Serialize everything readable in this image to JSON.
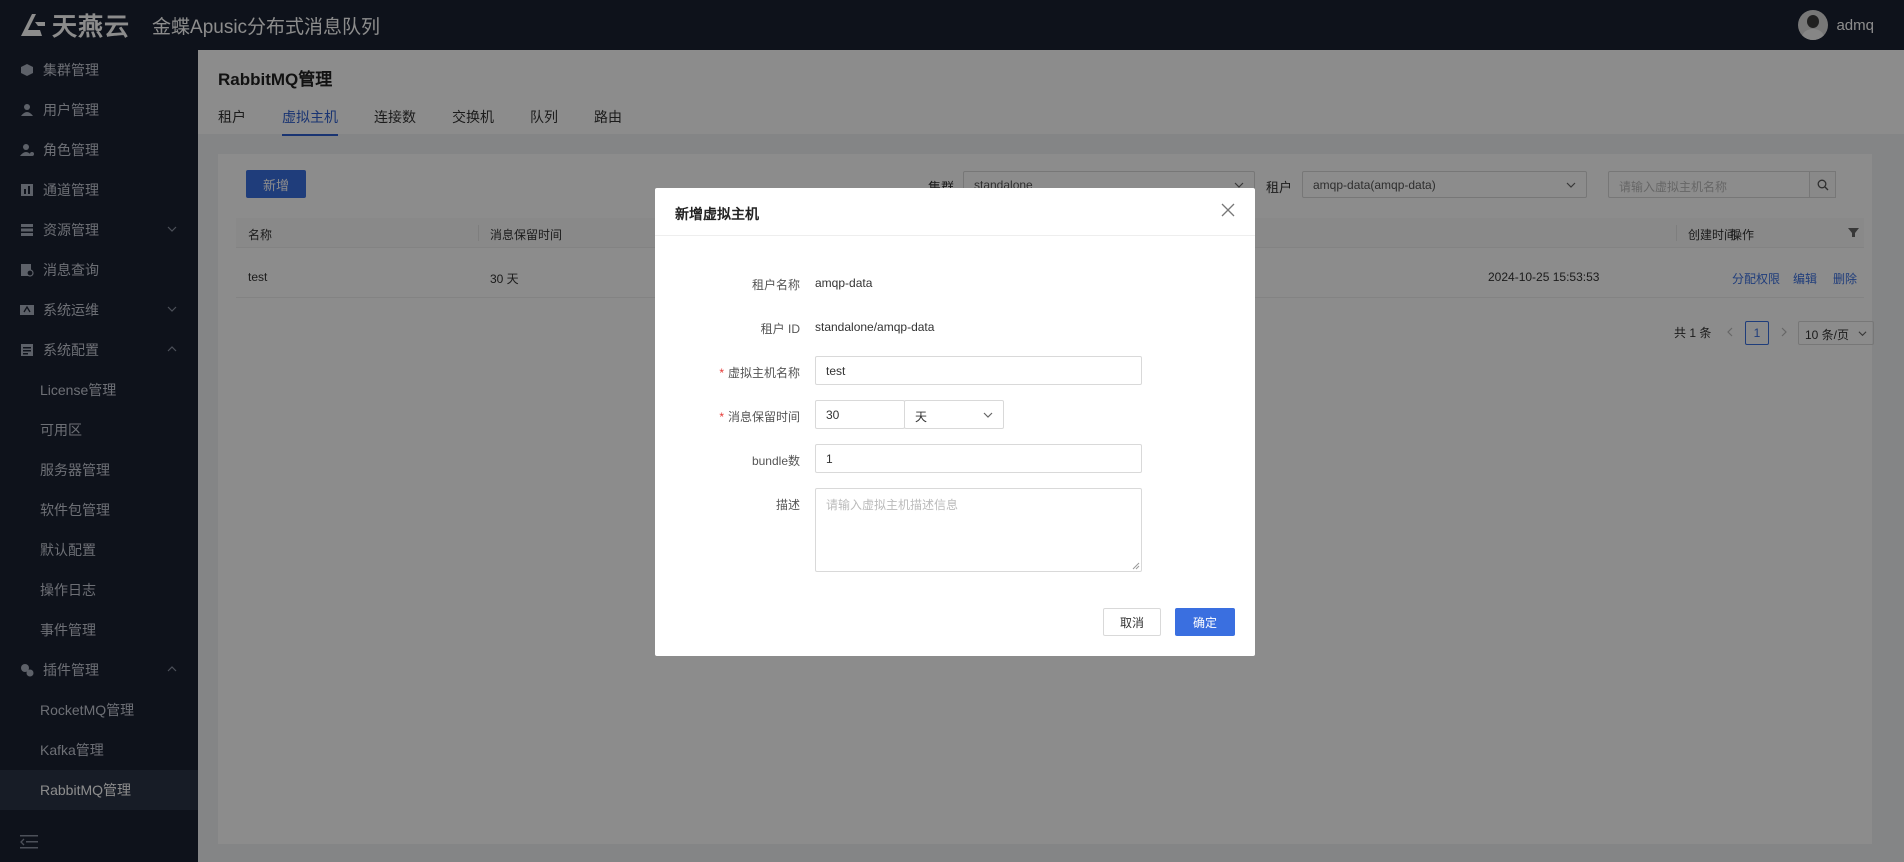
{
  "header": {
    "brand": "天燕云",
    "app_title": "金蝶Apusic分布式消息队列",
    "user_name": "admq"
  },
  "sidebar": {
    "items": [
      {
        "label": "集群管理",
        "icon": "cube-icon"
      },
      {
        "label": "用户管理",
        "icon": "user-icon"
      },
      {
        "label": "角色管理",
        "icon": "role-icon"
      },
      {
        "label": "通道管理",
        "icon": "channel-icon"
      },
      {
        "label": "资源管理",
        "icon": "server-icon",
        "expanded": false
      },
      {
        "label": "消息查询",
        "icon": "message-search-icon"
      },
      {
        "label": "系统运维",
        "icon": "ops-icon",
        "expanded": false
      },
      {
        "label": "系统配置",
        "icon": "config-icon",
        "expanded": true
      }
    ],
    "config_children": [
      "License管理",
      "可用区",
      "服务器管理",
      "软件包管理",
      "默认配置",
      "操作日志",
      "事件管理"
    ],
    "plugin": {
      "label": "插件管理",
      "icon": "plugin-icon",
      "expanded": true
    },
    "plugin_children": [
      "RocketMQ管理",
      "Kafka管理",
      "RabbitMQ管理"
    ],
    "active_item": "RabbitMQ管理"
  },
  "page": {
    "title": "RabbitMQ管理",
    "tabs": [
      "租户",
      "虚拟主机",
      "连接数",
      "交换机",
      "队列",
      "路由"
    ],
    "active_tab": "虚拟主机"
  },
  "toolbar": {
    "add_label": "新增",
    "cluster_label": "集群",
    "cluster_value": "standalone",
    "tenant_label": "租户",
    "tenant_value": "amqp-data(amqp-data)",
    "search_placeholder": "请输入虚拟主机名称"
  },
  "table": {
    "columns": [
      "名称",
      "消息保留时间",
      "创建时间",
      "操作"
    ],
    "rows": [
      {
        "name": "test",
        "retention": "30 天",
        "created": "2024-10-25 15:53:53",
        "actions": [
          "分配权限",
          "编辑",
          "删除"
        ]
      }
    ]
  },
  "pagination": {
    "total": "共 1 条",
    "current": "1",
    "page_size": "10 条/页"
  },
  "modal": {
    "title": "新增虚拟主机",
    "tenant_name_label": "租户名称",
    "tenant_name_value": "amqp-data",
    "tenant_id_label": "租户 ID",
    "tenant_id_value": "standalone/amqp-data",
    "vhost_name_label": "虚拟主机名称",
    "vhost_name_value": "test",
    "retention_label": "消息保留时间",
    "retention_value": "30",
    "retention_unit": "天",
    "bundle_label": "bundle数",
    "bundle_value": "1",
    "desc_label": "描述",
    "desc_placeholder": "请输入虚拟主机描述信息",
    "cancel_label": "取消",
    "ok_label": "确定",
    "required_mark": "*"
  },
  "colors": {
    "sidebar_bg": "#1b2232",
    "primary": "#3a6fe0",
    "required": "#e53935"
  }
}
